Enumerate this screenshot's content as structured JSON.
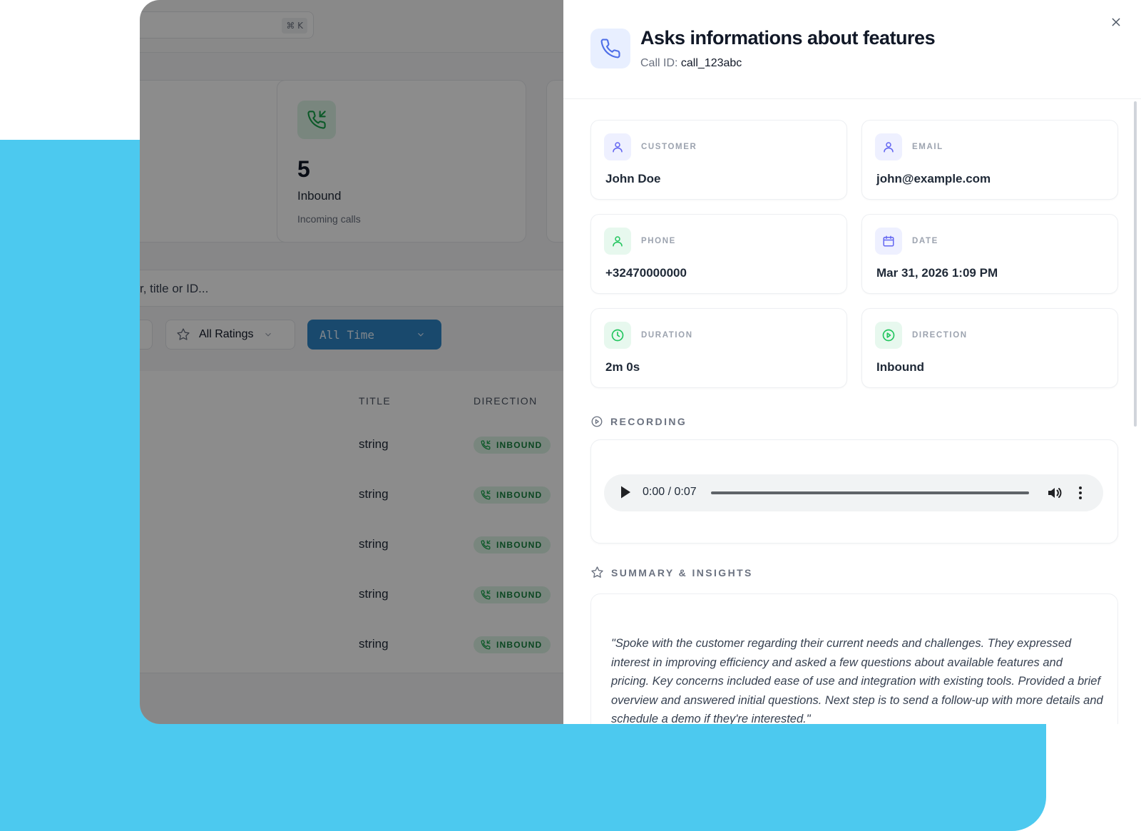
{
  "app": {
    "search_shortcut": "⌘ K",
    "stat_card": {
      "value": "5",
      "label": "Inbound",
      "sublabel": "Incoming calls"
    },
    "search_placeholder_visible": "r, title or ID...",
    "filters": {
      "ratings_label": "All Ratings",
      "time_label": "All Time"
    },
    "table": {
      "columns": [
        "TITLE",
        "DIRECTION"
      ],
      "rows": [
        {
          "title": "string",
          "direction": "INBOUND"
        },
        {
          "title": "string",
          "direction": "INBOUND"
        },
        {
          "title": "string",
          "direction": "INBOUND"
        },
        {
          "title": "string",
          "direction": "INBOUND"
        },
        {
          "title": "string",
          "direction": "INBOUND"
        }
      ]
    }
  },
  "panel": {
    "title": "Asks informations about features",
    "call_id_label": "Call ID:",
    "call_id": "call_123abc",
    "close_icon": "close-icon",
    "fields": [
      {
        "label": "CUSTOMER",
        "value": "John Doe",
        "icon": "user-icon",
        "accent": "#6366f1"
      },
      {
        "label": "EMAIL",
        "value": "john@example.com",
        "icon": "user-icon",
        "accent": "#6366f1"
      },
      {
        "label": "PHONE",
        "value": "+32470000000",
        "icon": "user-icon",
        "accent": "#22c55e"
      },
      {
        "label": "DATE",
        "value": "Mar 31, 2026 1:09 PM",
        "icon": "calendar-icon",
        "accent": "#6366f1"
      },
      {
        "label": "DURATION",
        "value": "2m 0s",
        "icon": "clock-icon",
        "accent": "#22c55e"
      },
      {
        "label": "DIRECTION",
        "value": "Inbound",
        "icon": "play-circle-icon",
        "accent": "#22c55e"
      }
    ],
    "recording": {
      "heading": "RECORDING",
      "time": "0:00 / 0:07",
      "progress": 0.0
    },
    "summary": {
      "heading": "SUMMARY & INSIGHTS",
      "text": "\"Spoke with the customer regarding their current needs and challenges. They expressed interest in improving efficiency and asked a few questions about available features and pricing. Key concerns included ease of use and integration with existing tools. Provided a brief overview and answered initial questions. Next step is to send a follow-up with more details and schedule a demo if they're interested.\""
    }
  },
  "colors": {
    "backdrop": "#4cc9ef",
    "accent_blue": "#2f86c6",
    "inbound_green": "#15803d"
  }
}
